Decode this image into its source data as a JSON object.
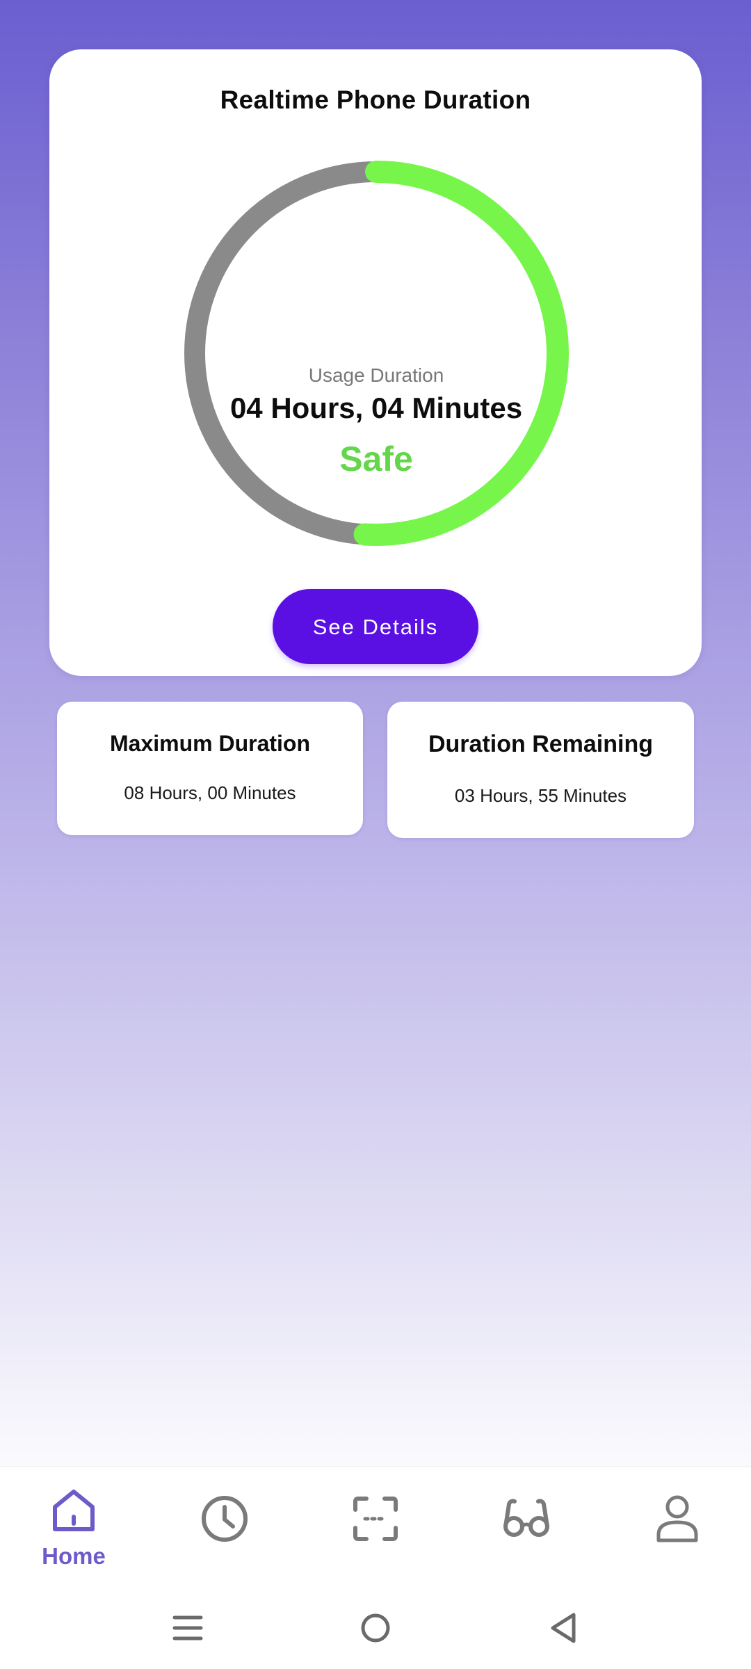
{
  "main_card": {
    "title": "Realtime Phone Duration",
    "gauge": {
      "label": "Usage Duration",
      "value": "04 Hours, 04 Minutes",
      "status": "Safe",
      "progress_fraction": 0.51,
      "track_color": "#8a8a8a",
      "progress_color": "#77f54a",
      "status_color": "#63d64a"
    },
    "details_button_label": "See Details"
  },
  "stats": {
    "max_title": "Maximum Duration",
    "max_value": "08 Hours, 00 Minutes",
    "remaining_title": "Duration Remaining",
    "remaining_value": "03 Hours, 55 Minutes"
  },
  "bottom_nav": {
    "active_color": "#6c5cc9",
    "inactive_color": "#7a7a7a",
    "items": [
      {
        "icon": "home-icon",
        "label": "Home",
        "active": true
      },
      {
        "icon": "clock-icon",
        "label": "",
        "active": false
      },
      {
        "icon": "scan-icon",
        "label": "",
        "active": false
      },
      {
        "icon": "glasses-icon",
        "label": "",
        "active": false
      },
      {
        "icon": "user-icon",
        "label": "",
        "active": false
      }
    ]
  },
  "system_nav": {
    "icons": [
      "recents-icon",
      "home-circle-icon",
      "back-icon"
    ]
  }
}
